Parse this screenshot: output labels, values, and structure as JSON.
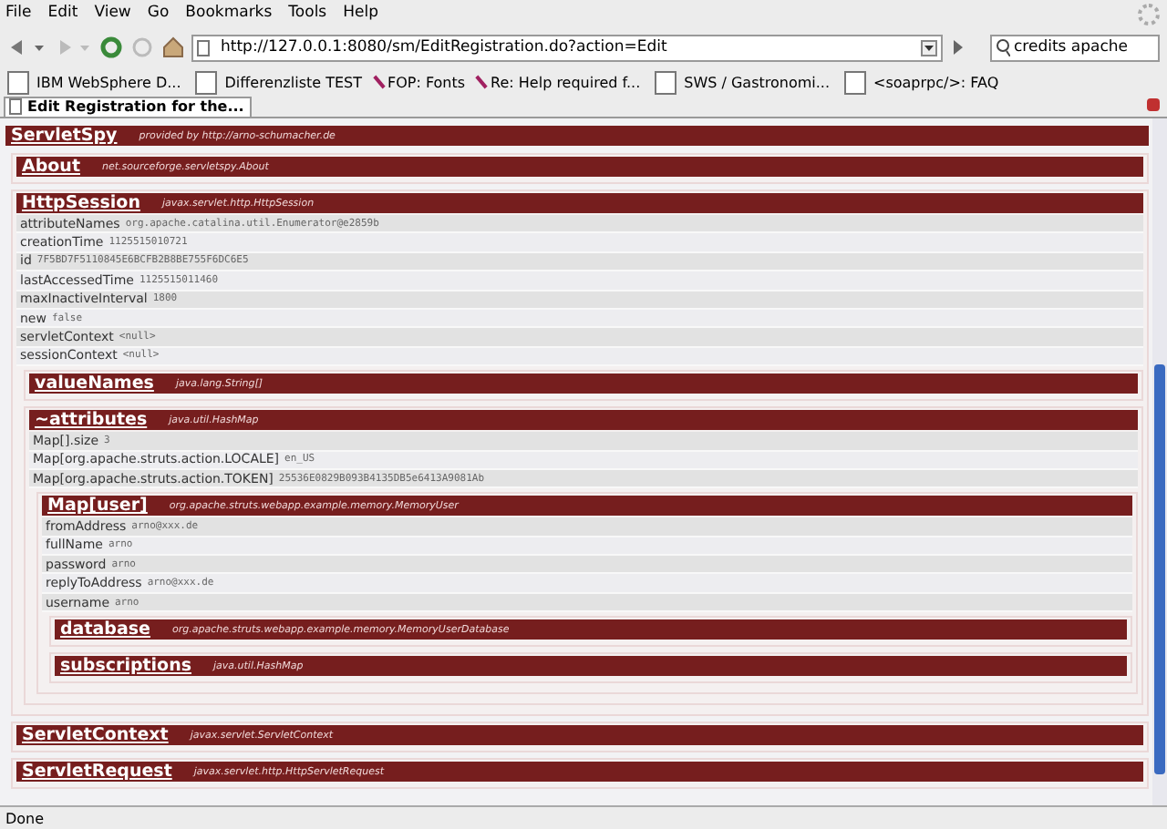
{
  "menu": [
    "File",
    "Edit",
    "View",
    "Go",
    "Bookmarks",
    "Tools",
    "Help"
  ],
  "address": {
    "value": "http://127.0.0.1:8080/sm/EditRegistration.do?action=Edit"
  },
  "search": {
    "value": "credits apache"
  },
  "bookmarks": [
    {
      "label": "IBM WebSphere D...",
      "kind": "page"
    },
    {
      "label": "Differenzliste TEST",
      "kind": "page"
    },
    {
      "label": "FOP: Fonts",
      "kind": "feed"
    },
    {
      "label": "Re: Help required f...",
      "kind": "feed"
    },
    {
      "label": "SWS / Gastronomi...",
      "kind": "page"
    },
    {
      "label": "<soaprpc/>: FAQ",
      "kind": "page"
    }
  ],
  "tab": {
    "label": "Edit Registration for the..."
  },
  "content": {
    "title": "ServletSpy",
    "type": "provided by http://arno-schumacher.de",
    "children": [
      {
        "title": "About",
        "type": "net.sourceforge.servletspy.About"
      },
      {
        "title": "HttpSession",
        "type": "javax.servlet.http.HttpSession",
        "properties": [
          {
            "name": "attributeNames",
            "value": "org.apache.catalina.util.Enumerator@e2859b"
          },
          {
            "name": "creationTime",
            "value": "1125515010721"
          },
          {
            "name": "id",
            "value": "7F5BD7F5110845E6BCFB2B8BE755F6DC6E5"
          },
          {
            "name": "lastAccessedTime",
            "value": "1125515011460"
          },
          {
            "name": "maxInactiveInterval",
            "value": "1800"
          },
          {
            "name": "new",
            "value": "false"
          },
          {
            "name": "servletContext",
            "value": "<null>"
          },
          {
            "name": "sessionContext",
            "value": "<null>"
          }
        ],
        "children": [
          {
            "title": "valueNames",
            "type": "java.lang.String[]"
          },
          {
            "title": "~attributes",
            "type": "java.util.HashMap",
            "properties": [
              {
                "name": "Map[].size",
                "value": "3"
              },
              {
                "name": "Map[org.apache.struts.action.LOCALE]",
                "value": "en_US"
              },
              {
                "name": "Map[org.apache.struts.action.TOKEN]",
                "value": "25536E0829B093B4135DB5e6413A9081Ab"
              }
            ],
            "children": [
              {
                "title": "Map[user]",
                "type": "org.apache.struts.webapp.example.memory.MemoryUser",
                "properties": [
                  {
                    "name": "fromAddress",
                    "value": "arno@xxx.de"
                  },
                  {
                    "name": "fullName",
                    "value": "arno"
                  },
                  {
                    "name": "password",
                    "value": "arno"
                  },
                  {
                    "name": "replyToAddress",
                    "value": "arno@xxx.de"
                  },
                  {
                    "name": "username",
                    "value": "arno"
                  }
                ],
                "children": [
                  {
                    "title": "database",
                    "type": "org.apache.struts.webapp.example.memory.MemoryUserDatabase"
                  },
                  {
                    "title": "subscriptions",
                    "type": "java.util.HashMap"
                  }
                ]
              }
            ]
          }
        ]
      },
      {
        "title": "ServletContext",
        "type": "javax.servlet.ServletContext"
      },
      {
        "title": "ServletRequest",
        "type": "javax.servlet.http.HttpServletRequest"
      }
    ]
  },
  "status": "Done"
}
